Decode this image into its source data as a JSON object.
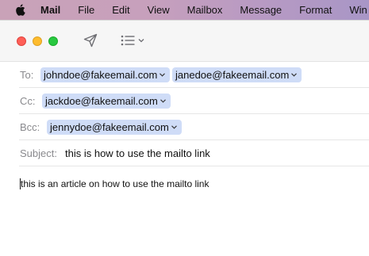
{
  "menubar": {
    "items": [
      "Mail",
      "File",
      "Edit",
      "View",
      "Mailbox",
      "Message",
      "Format",
      "Win"
    ]
  },
  "compose": {
    "to_label": "To:",
    "cc_label": "Cc:",
    "bcc_label": "Bcc:",
    "subject_label": "Subject:",
    "to": [
      "johndoe@fakeemail.com",
      "janedoe@fakeemail.com"
    ],
    "cc": [
      "jackdoe@fakeemail.com"
    ],
    "bcc": [
      "jennydoe@fakeemail.com"
    ],
    "subject": "this is how to use the mailto link",
    "body": "this is an article on how to use the mailto link"
  },
  "colors": {
    "chip": "#cfdcf7",
    "close": "#ff5f57",
    "minimize": "#febc2e",
    "zoom": "#28c840"
  }
}
